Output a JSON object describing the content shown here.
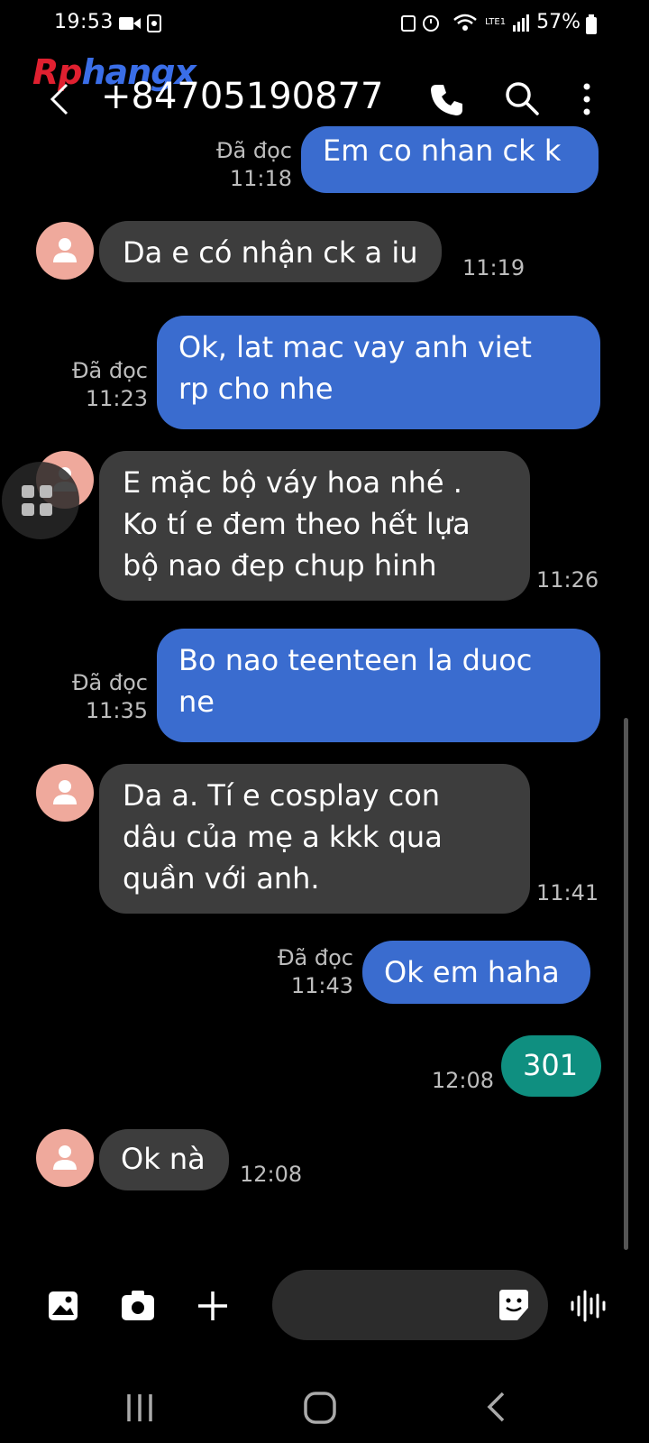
{
  "status_bar": {
    "time": "19:53",
    "battery": "57%",
    "network": "LTE1"
  },
  "watermark": {
    "part_a": "Rp",
    "part_b": "hangx"
  },
  "header": {
    "contact": "+84705190877",
    "icons": [
      "back-icon",
      "call-icon",
      "search-icon",
      "more-icon"
    ]
  },
  "messages": [
    {
      "dir": "sent",
      "text": "Em co nhan ck k",
      "status": "Đã đọc",
      "time": "11:18"
    },
    {
      "dir": "recv",
      "text": "Da e có nhận ck a iu",
      "time": "11:19"
    },
    {
      "dir": "sent",
      "text": "Ok, lat mac vay anh viet\nrp cho nhe",
      "status": "Đã đọc",
      "time": "11:23"
    },
    {
      "dir": "recv",
      "text": "E mặc bộ váy hoa nhé .\nKo tí e đem theo hết lựa\nbộ nao đep chup hinh",
      "time": "11:26"
    },
    {
      "dir": "sent",
      "text": "Bo nao teenteen la duoc\nne",
      "status": "Đã đọc",
      "time": "11:35"
    },
    {
      "dir": "recv",
      "text": "Da a. Tí e cosplay con\ndâu của mẹ a kkk qua\nquần với anh.",
      "time": "11:41"
    },
    {
      "dir": "sent",
      "text": "Ok em haha",
      "status": "Đã đọc",
      "time": "11:43"
    },
    {
      "dir": "sent",
      "text": "301",
      "time": "12:08"
    },
    {
      "dir": "recv",
      "text": "Ok nà",
      "time": "12:08"
    }
  ],
  "composer": {
    "placeholder": "",
    "icons": [
      "gallery-icon",
      "camera-icon",
      "plus-icon",
      "sticker-icon",
      "voice-icon"
    ]
  },
  "colors": {
    "sent_bubble": "#3a6ccf",
    "recv_bubble": "#3d3d3d",
    "green_bubble": "#0f8f80",
    "avatar": "#efa99c"
  }
}
